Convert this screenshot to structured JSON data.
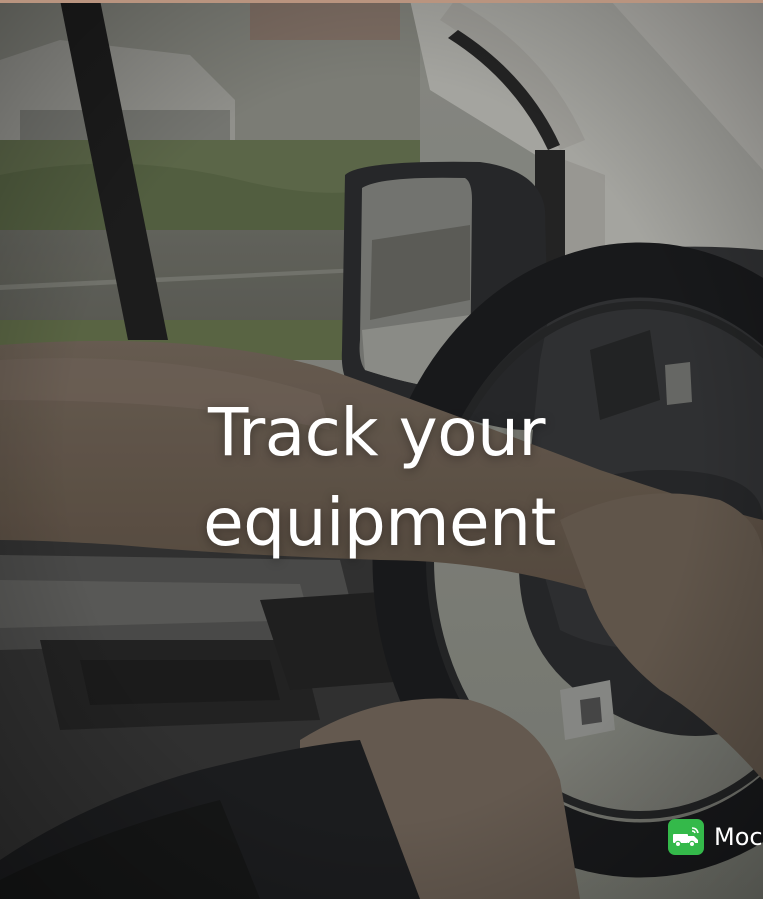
{
  "headline": {
    "line1": "Track your",
    "line2": "equipment"
  },
  "badge": {
    "icon": "delivery-truck-icon",
    "text": "Moc",
    "color": "#34b94a"
  }
}
